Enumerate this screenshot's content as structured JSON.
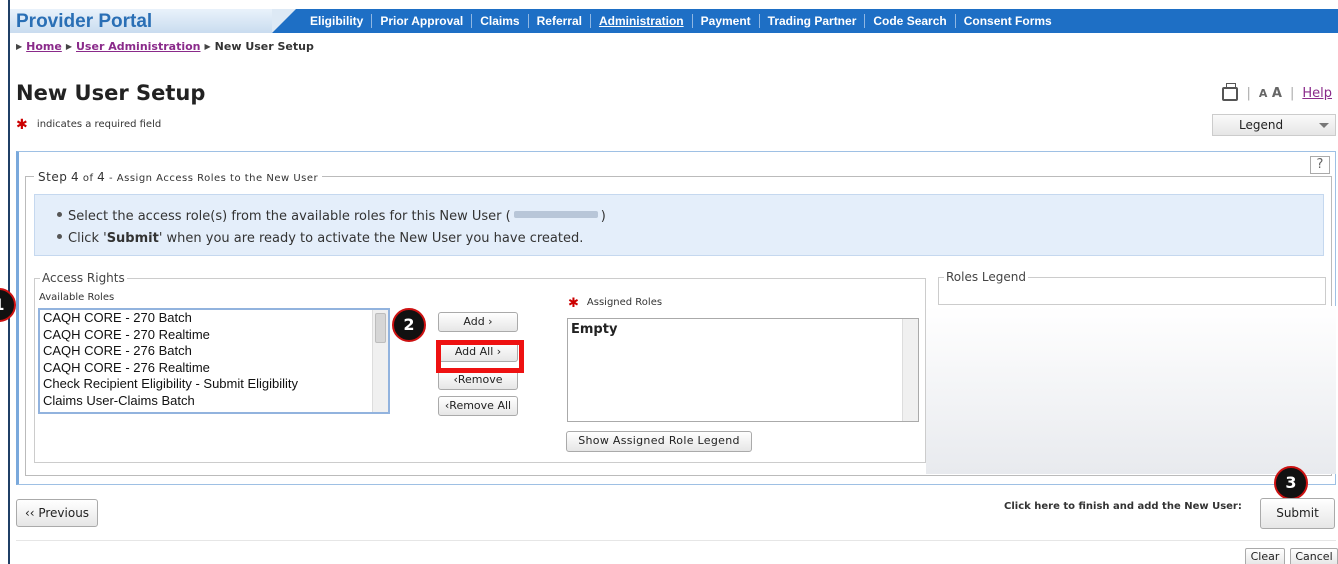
{
  "header": {
    "brand": "Provider Portal",
    "nav": [
      "Eligibility",
      "Prior Approval",
      "Claims",
      "Referral",
      "Administration",
      "Payment",
      "Trading Partner",
      "Code Search",
      "Consent Forms"
    ],
    "active_nav": "Administration"
  },
  "breadcrumb": {
    "home": "Home",
    "user_admin": "User Administration",
    "current": "New User Setup"
  },
  "page": {
    "title": "New User Setup",
    "required_note": "indicates a required field",
    "required_mark": "✱",
    "font_small": "A",
    "font_large": "A",
    "help": "Help",
    "legend_dropdown": "Legend",
    "help_icon": "?"
  },
  "step": {
    "label_prefix": "Step",
    "num": "4",
    "of": "of",
    "total": "4",
    "description": " - Assign Access Roles to the New User"
  },
  "instructions": {
    "line1_pre": "Select the access role(s) from the available roles for this New User (",
    "line1_post": ")",
    "line2_pre": "Click '",
    "line2_bold": "Submit",
    "line2_post": "' when you are ready to activate the New User you have created."
  },
  "access_rights": {
    "legend": "Access Rights",
    "available_label": "Available Roles",
    "available_roles": [
      "CAQH CORE - 270 Batch",
      "CAQH CORE - 270 Realtime",
      "CAQH CORE - 276 Batch",
      "CAQH CORE - 276 Realtime",
      "Check Recipient Eligibility - Submit Eligibility",
      "Claims User-Claims Batch"
    ],
    "buttons": {
      "add": "Add ›",
      "add_all": "Add All ›",
      "remove": "‹Remove",
      "remove_all": "‹Remove All"
    },
    "assigned_label": "Assigned Roles",
    "assigned_empty": "Empty",
    "show_legend": "Show Assigned Role Legend"
  },
  "roles_legend": {
    "label": "Roles Legend"
  },
  "callouts": [
    "1",
    "2",
    "3"
  ],
  "footer": {
    "previous": "‹‹ Previous",
    "finish_text": "Click here to finish and add the New User:",
    "submit": "Submit",
    "clear": "Clear",
    "cancel": "Cancel"
  },
  "colors": {
    "nav_bg": "#1e6fc5",
    "brand": "#2a6fb5",
    "link": "#8a2a8a",
    "highlight": "#ee1111",
    "info_bg": "#e4eefa"
  }
}
